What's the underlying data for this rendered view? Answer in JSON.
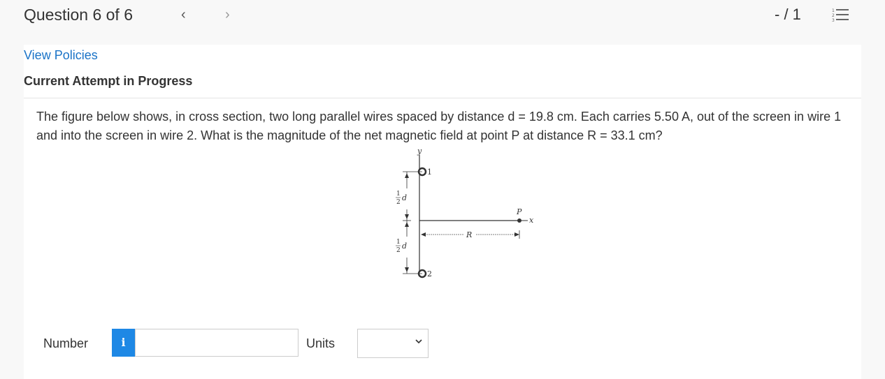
{
  "header": {
    "question_label": "Question 6 of 6",
    "prev_icon": "chevron-left-icon",
    "next_icon": "chevron-right-icon",
    "score": "- / 1",
    "list_icon": "numbered-list-icon"
  },
  "card": {
    "view_policies": "View Policies",
    "attempt_status": "Current Attempt in Progress",
    "question_text": "The figure below shows, in cross section, two long parallel wires spaced by distance d = 19.8 cm. Each carries 5.50 A, out of the screen in wire 1 and into the screen in wire 2. What is the magnitude of the net magnetic field at point P at distance R = 33.1 cm?"
  },
  "figure": {
    "y_axis_label": "y",
    "x_axis_label": "x",
    "wire1_label": "1",
    "wire2_label": "2",
    "point_label": "P",
    "distance_label": "R",
    "half_top": "1",
    "half_bottom": "2",
    "d_symbol": "d"
  },
  "answer": {
    "number_label": "Number",
    "info_icon": "info-icon",
    "info_glyph": "i",
    "number_value": "",
    "units_label": "Units",
    "units_selected": "",
    "accent_color": "#1e88e5"
  }
}
